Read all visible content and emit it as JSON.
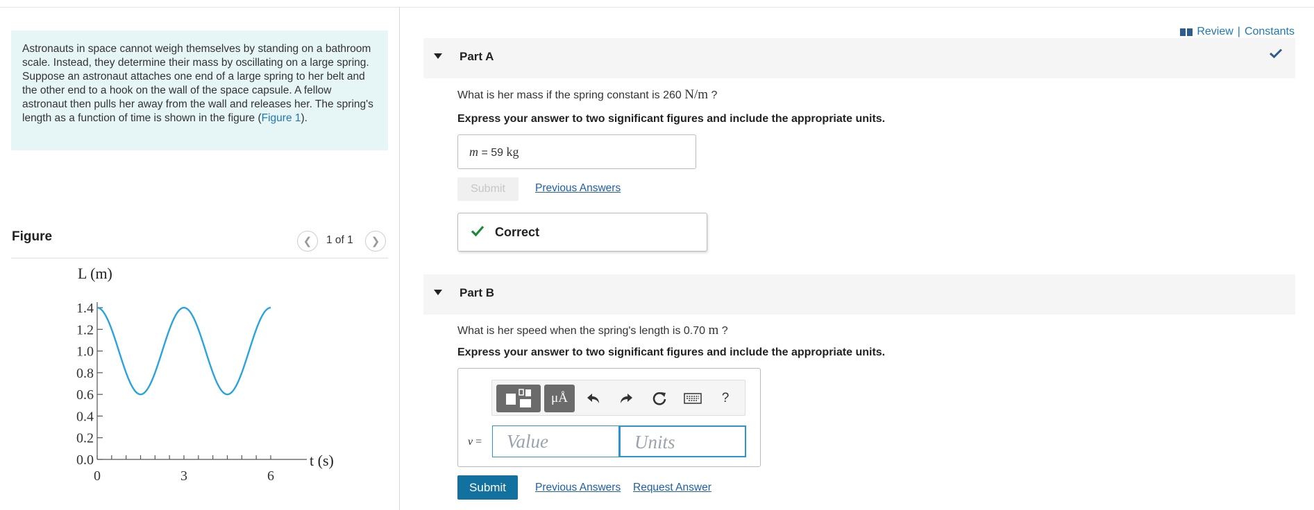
{
  "problem": {
    "text": "Astronauts in space cannot weigh themselves by standing on a bathroom scale. Instead, they determine their mass by oscillating on a large spring. Suppose an astronaut attaches one end of a large spring to her belt and the other end to a hook on the wall of the space capsule. A fellow astronaut then pulls her away from the wall and releases her. The spring's length as a function of time is shown in the figure (",
    "figure_link": "Figure 1",
    "text_end": ")."
  },
  "figure_panel": {
    "title": "Figure",
    "pager": "1 of 1",
    "prev_icon": "chevron-left-icon",
    "next_icon": "chevron-right-icon"
  },
  "header": {
    "review": "Review",
    "separator": "|",
    "constants": "Constants"
  },
  "part_a": {
    "label": "Part A",
    "question": "What is her mass if the spring constant is 260 ",
    "question_unit": "N/m",
    "question_end": " ?",
    "instruction": "Express your answer to two significant figures and include the appropriate units.",
    "answer_var": "m",
    "answer_eq": " = ",
    "answer_value": "59",
    "answer_unit": "kg",
    "submit": "Submit",
    "previous_answers": "Previous Answers",
    "result": "Correct"
  },
  "part_b": {
    "label": "Part B",
    "question": "What is her speed when the spring's length is 0.70 ",
    "question_unit": "m",
    "question_end": " ?",
    "instruction": "Express your answer to two significant figures and include the appropriate units.",
    "toolbar": {
      "mu_label": "μÅ",
      "help": "?"
    },
    "input_var": "v",
    "input_eq": " =",
    "value_placeholder": "Value",
    "units_placeholder": "Units",
    "submit": "Submit",
    "previous_answers": "Previous Answers",
    "request_answer": "Request Answer"
  },
  "colors": {
    "accent": "#12719e",
    "link": "#1f78b4",
    "correct": "#1a8a3a",
    "curve": "#29a3e0"
  },
  "chart_data": {
    "type": "line",
    "ylabel": "L (m)",
    "xlabel": "t (s)",
    "xlim": [
      0,
      6
    ],
    "ylim": [
      0,
      1.4
    ],
    "x_tick_labels": [
      "0",
      "3",
      "6"
    ],
    "x_minor_ticks": [
      0,
      0.5,
      1,
      1.5,
      2,
      2.5,
      3,
      3.5,
      4,
      4.5,
      5,
      5.5,
      6
    ],
    "y_tick_labels": [
      "0.0",
      "0.2",
      "0.4",
      "0.6",
      "0.8",
      "1.0",
      "1.2",
      "1.4"
    ],
    "series": [
      {
        "function": "L = 1.0 + 0.4*cos(2*pi*t/3)",
        "x_range": [
          0,
          6
        ],
        "max": 1.4,
        "min": 0.6,
        "period": 3
      }
    ]
  }
}
